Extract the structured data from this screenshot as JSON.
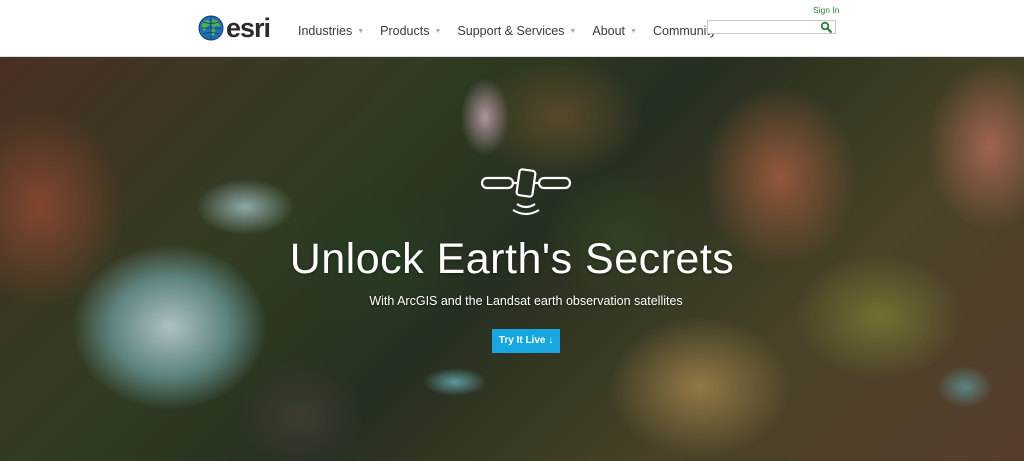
{
  "header": {
    "logo_text": "esri",
    "nav": [
      {
        "label": "Industries"
      },
      {
        "label": "Products"
      },
      {
        "label": "Support & Services"
      },
      {
        "label": "About"
      },
      {
        "label": "Community"
      }
    ],
    "sign_in": "Sign In",
    "search": {
      "placeholder": "",
      "value": "",
      "icon": "search-icon"
    }
  },
  "hero": {
    "icon": "satellite-icon",
    "title": "Unlock Earth's Secrets",
    "subtitle": "With ArcGIS and the Landsat earth observation satellites",
    "cta_label": "Try It Live ↓"
  },
  "colors": {
    "accent": "#17a7e0",
    "sign_in": "#2e7d32",
    "search_icon": "#2e7d32",
    "globe_blue": "#1d6fb8",
    "globe_green": "#4caf50"
  }
}
